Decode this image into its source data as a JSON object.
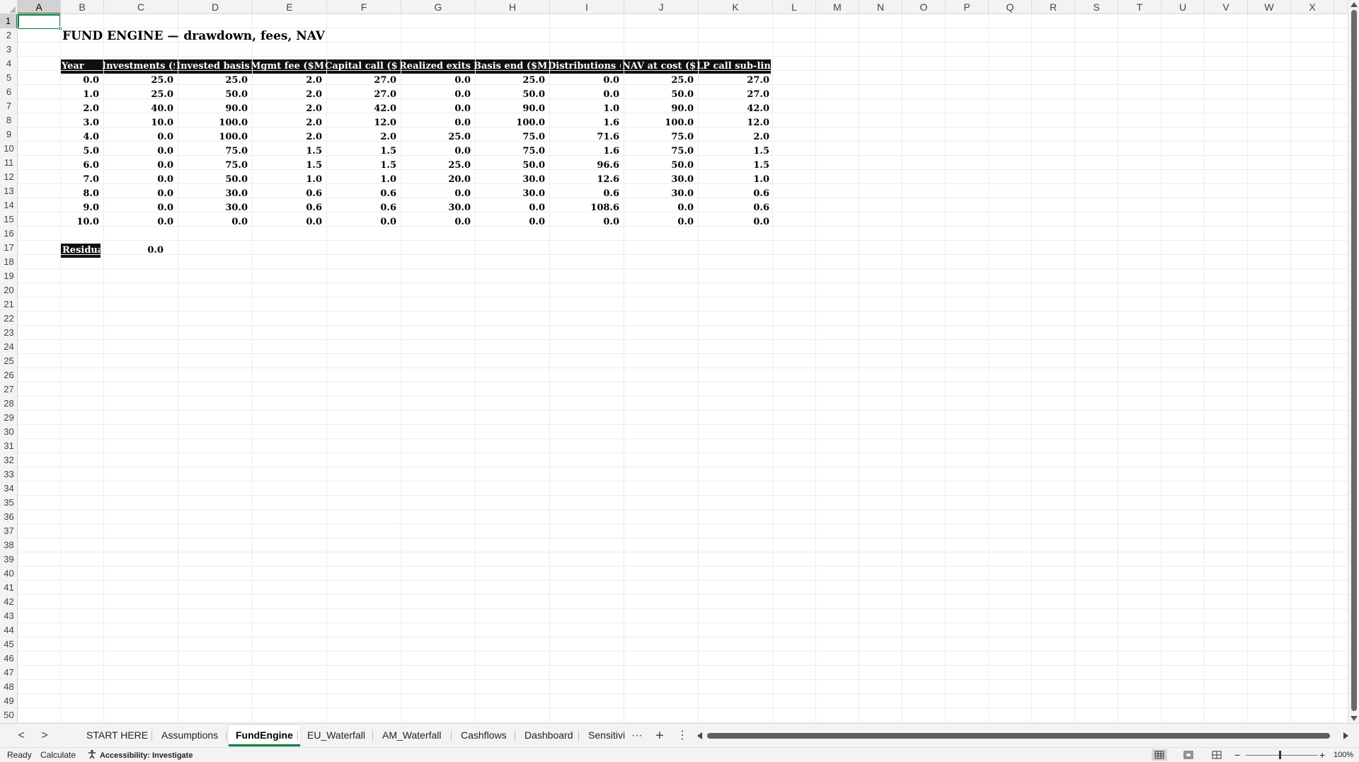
{
  "sheet": {
    "title": "FUND ENGINE — drawdown, fees, NAV",
    "columns": [
      "A",
      "B",
      "C",
      "D",
      "E",
      "F",
      "G",
      "H",
      "I",
      "J",
      "K",
      "L",
      "M",
      "N",
      "O",
      "P",
      "Q",
      "R",
      "S",
      "T",
      "U",
      "V",
      "W",
      "X"
    ],
    "active_column": "A",
    "row_count": 50,
    "active_row": 1,
    "table_headers": [
      "Year",
      "Investments ($",
      "Invested basis",
      "Mgmt fee ($M)",
      "Capital call ($M",
      "Realized exits",
      "Basis end ($M)",
      "Distributions (",
      "NAV at cost ($M",
      "LP call sub-line"
    ],
    "table_rows": [
      [
        "0.0",
        "25.0",
        "25.0",
        "2.0",
        "27.0",
        "0.0",
        "25.0",
        "0.0",
        "25.0",
        "27.0"
      ],
      [
        "1.0",
        "25.0",
        "50.0",
        "2.0",
        "27.0",
        "0.0",
        "50.0",
        "0.0",
        "50.0",
        "27.0"
      ],
      [
        "2.0",
        "40.0",
        "90.0",
        "2.0",
        "42.0",
        "0.0",
        "90.0",
        "1.0",
        "90.0",
        "42.0"
      ],
      [
        "3.0",
        "10.0",
        "100.0",
        "2.0",
        "12.0",
        "0.0",
        "100.0",
        "1.6",
        "100.0",
        "12.0"
      ],
      [
        "4.0",
        "0.0",
        "100.0",
        "2.0",
        "2.0",
        "25.0",
        "75.0",
        "71.6",
        "75.0",
        "2.0"
      ],
      [
        "5.0",
        "0.0",
        "75.0",
        "1.5",
        "1.5",
        "0.0",
        "75.0",
        "1.6",
        "75.0",
        "1.5"
      ],
      [
        "6.0",
        "0.0",
        "75.0",
        "1.5",
        "1.5",
        "25.0",
        "50.0",
        "96.6",
        "50.0",
        "1.5"
      ],
      [
        "7.0",
        "0.0",
        "50.0",
        "1.0",
        "1.0",
        "20.0",
        "30.0",
        "12.6",
        "30.0",
        "1.0"
      ],
      [
        "8.0",
        "0.0",
        "30.0",
        "0.6",
        "0.6",
        "0.0",
        "30.0",
        "0.6",
        "30.0",
        "0.6"
      ],
      [
        "9.0",
        "0.0",
        "30.0",
        "0.6",
        "0.6",
        "30.0",
        "0.0",
        "108.6",
        "0.0",
        "0.6"
      ],
      [
        "10.0",
        "0.0",
        "0.0",
        "0.0",
        "0.0",
        "0.0",
        "0.0",
        "0.0",
        "0.0",
        "0.0"
      ]
    ],
    "residual_label": "Residua",
    "residual_value": "0.0"
  },
  "tabs": [
    "START HERE",
    "Assumptions",
    "FundEngine",
    "EU_Waterfall",
    "AM_Waterfall",
    "Cashflows",
    "Dashboard",
    "Sensitivi"
  ],
  "active_tab": "FundEngine",
  "tab_more": "···",
  "tab_add": "+",
  "tab_options": "⋮",
  "nav": {
    "prev": "<",
    "next": ">"
  },
  "status": {
    "ready": "Ready",
    "calculate": "Calculate",
    "accessibility": "Accessibility: Investigate",
    "zoom_minus": "−",
    "zoom_plus": "+",
    "zoom": "100%"
  },
  "colors": {
    "accent": "#107c41",
    "header_band": "#0e1111"
  }
}
